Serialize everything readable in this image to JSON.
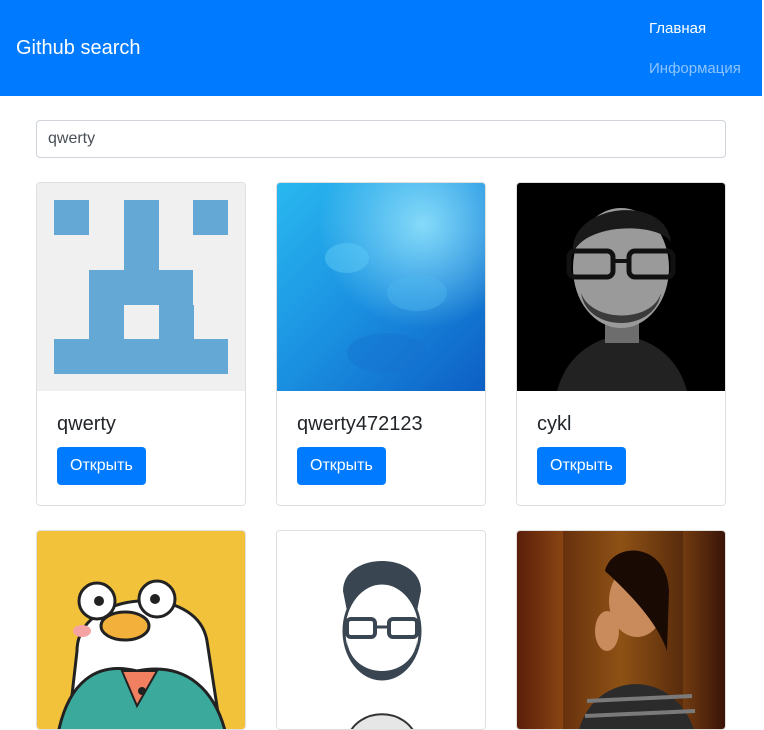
{
  "navbar": {
    "brand": "Github search",
    "links": [
      {
        "label": "Главная",
        "active": true
      },
      {
        "label": "Информация",
        "active": false
      }
    ],
    "color": "#007bff"
  },
  "search": {
    "value": "qwerty",
    "placeholder": ""
  },
  "cards": [
    {
      "login": "qwerty",
      "button_label": "Открыть",
      "avatar": "identicon-blue"
    },
    {
      "login": "qwerty472123",
      "button_label": "Открыть",
      "avatar": "blue-watercolor"
    },
    {
      "login": "cykl",
      "button_label": "Открыть",
      "avatar": "bw-portrait-glasses"
    },
    {
      "avatar": "cartoon-duck-yellow"
    },
    {
      "avatar": "cartoon-bearded-man-glasses"
    },
    {
      "avatar": "woman-portrait-warm"
    }
  ]
}
